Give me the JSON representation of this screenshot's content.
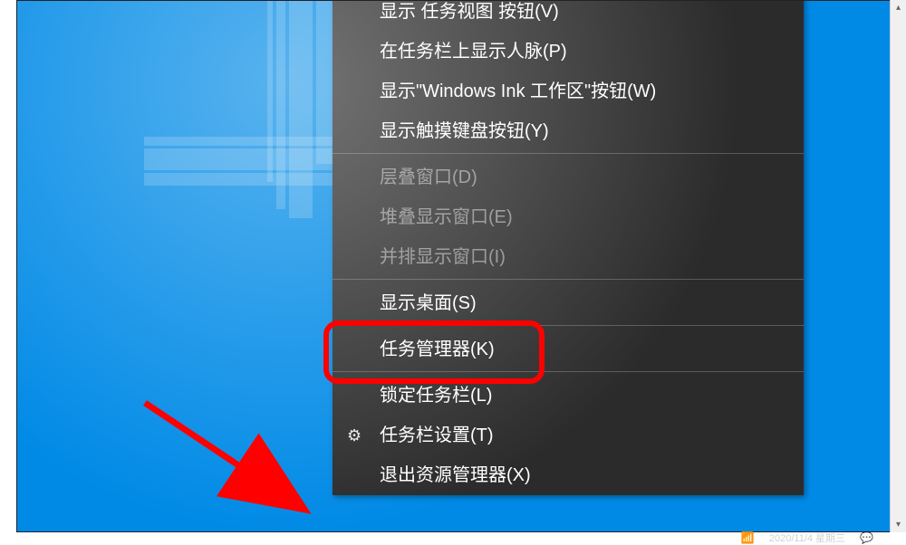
{
  "menu": {
    "groups": [
      {
        "items": [
          {
            "label": "显示 任务视图 按钮(V)",
            "enabled": true,
            "icon": null,
            "name": "menu-item-task-view"
          },
          {
            "label": "在任务栏上显示人脉(P)",
            "enabled": true,
            "icon": null,
            "name": "menu-item-people"
          },
          {
            "label": "显示\"Windows Ink 工作区\"按钮(W)",
            "enabled": true,
            "icon": null,
            "name": "menu-item-ink-workspace"
          },
          {
            "label": "显示触摸键盘按钮(Y)",
            "enabled": true,
            "icon": null,
            "name": "menu-item-touch-keyboard"
          }
        ]
      },
      {
        "items": [
          {
            "label": "层叠窗口(D)",
            "enabled": false,
            "icon": null,
            "name": "menu-item-cascade"
          },
          {
            "label": "堆叠显示窗口(E)",
            "enabled": false,
            "icon": null,
            "name": "menu-item-stack"
          },
          {
            "label": "并排显示窗口(I)",
            "enabled": false,
            "icon": null,
            "name": "menu-item-sidebyside"
          }
        ]
      },
      {
        "items": [
          {
            "label": "显示桌面(S)",
            "enabled": true,
            "icon": null,
            "name": "menu-item-show-desktop"
          }
        ]
      },
      {
        "items": [
          {
            "label": "任务管理器(K)",
            "enabled": true,
            "icon": null,
            "name": "menu-item-task-manager",
            "highlighted": true
          }
        ]
      },
      {
        "items": [
          {
            "label": "锁定任务栏(L)",
            "enabled": true,
            "icon": null,
            "name": "menu-item-lock-taskbar"
          },
          {
            "label": "任务栏设置(T)",
            "enabled": true,
            "icon": "gear",
            "name": "menu-item-taskbar-settings"
          },
          {
            "label": "退出资源管理器(X)",
            "enabled": true,
            "icon": null,
            "name": "menu-item-exit-explorer"
          }
        ]
      }
    ]
  },
  "annotation": {
    "highlight_target": "menu-item-task-manager",
    "highlight_color": "#ff0000",
    "arrow_color": "#ff0000"
  },
  "system_tray": {
    "date": "2020/11/4 星期三",
    "icons": [
      "chat-icon",
      "wifi-icon"
    ]
  }
}
